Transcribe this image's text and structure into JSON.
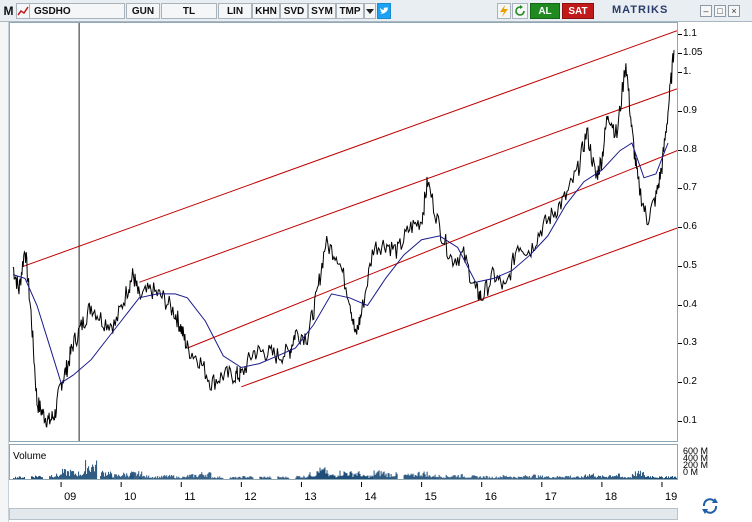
{
  "toolbar": {
    "menu_label": "M",
    "symbol": "GSDHO",
    "period": "GUN",
    "currency": "TL",
    "scale": "LIN",
    "khn": "KHN",
    "svd": "SVD",
    "sym": "SYM",
    "tmp": "TMP",
    "buy": "AL",
    "sell": "SAT",
    "brand": "MATRIKS"
  },
  "volume": {
    "title": "Volume",
    "scale_labels": [
      "600 M",
      "400 M",
      "200 M",
      "0 M"
    ]
  },
  "colors": {
    "price": "#000000",
    "moving_average": "#1a1a8c",
    "channel": "#c00000",
    "volume_bar": "#1f4e79"
  },
  "chart_data": {
    "type": "line",
    "title": "",
    "xlabel": "",
    "ylabel": "",
    "x_ticks": [
      "09",
      "10",
      "11",
      "12",
      "13",
      "14",
      "15",
      "16",
      "17",
      "18",
      "19"
    ],
    "y_ticks": [
      "0.1",
      "0.2",
      "0.3",
      "0.4",
      "0.5",
      "0.6",
      "0.7",
      "0.8",
      "0.9",
      "1.",
      "1.05",
      "1.1"
    ],
    "ylim": [
      0.05,
      1.13
    ],
    "xlim": [
      2008.15,
      2019.25
    ],
    "grid": false,
    "series": [
      {
        "x": [
          2008.2,
          2008.3,
          2008.4,
          2008.5,
          2008.6,
          2008.7,
          2008.8,
          2008.9,
          2009.0,
          2009.1,
          2009.2,
          2009.35,
          2009.5,
          2009.7,
          2009.9,
          2010.1,
          2010.2,
          2010.3,
          2010.5,
          2010.7,
          2010.9,
          2011.0,
          2011.1,
          2011.3,
          2011.5,
          2011.7,
          2011.9,
          2012.0,
          2012.2,
          2012.4,
          2012.6,
          2012.8,
          2012.9,
          2013.1,
          2013.25,
          2013.4,
          2013.6,
          2013.8,
          2013.9,
          2014.0,
          2014.2,
          2014.4,
          2014.6,
          2014.8,
          2015.0,
          2015.1,
          2015.3,
          2015.5,
          2015.7,
          2015.9,
          2016.0,
          2016.2,
          2016.4,
          2016.6,
          2016.8,
          2017.0,
          2017.2,
          2017.4,
          2017.6,
          2017.75,
          2017.9,
          2018.0,
          2018.1,
          2018.25,
          2018.4,
          2018.5,
          2018.6,
          2018.75,
          2018.9,
          2019.0,
          2019.1,
          2019.2
        ],
        "values": [
          0.5,
          0.44,
          0.55,
          0.38,
          0.15,
          0.12,
          0.1,
          0.12,
          0.2,
          0.24,
          0.3,
          0.35,
          0.4,
          0.36,
          0.35,
          0.44,
          0.48,
          0.42,
          0.44,
          0.42,
          0.38,
          0.34,
          0.29,
          0.26,
          0.2,
          0.22,
          0.22,
          0.22,
          0.28,
          0.28,
          0.27,
          0.28,
          0.33,
          0.32,
          0.42,
          0.56,
          0.53,
          0.42,
          0.32,
          0.38,
          0.55,
          0.56,
          0.54,
          0.6,
          0.62,
          0.72,
          0.6,
          0.52,
          0.53,
          0.44,
          0.42,
          0.48,
          0.44,
          0.56,
          0.54,
          0.6,
          0.64,
          0.68,
          0.75,
          0.85,
          0.73,
          0.78,
          0.9,
          0.84,
          1.03,
          0.85,
          0.72,
          0.62,
          0.68,
          0.76,
          0.9,
          1.06
        ]
      },
      {
        "x": [
          2008.2,
          2008.4,
          2008.6,
          2008.8,
          2009.0,
          2009.2,
          2009.5,
          2009.8,
          2010.0,
          2010.3,
          2010.6,
          2010.9,
          2011.1,
          2011.4,
          2011.7,
          2012.0,
          2012.3,
          2012.6,
          2012.9,
          2013.2,
          2013.5,
          2013.8,
          2014.1,
          2014.4,
          2014.7,
          2015.0,
          2015.3,
          2015.6,
          2015.9,
          2016.2,
          2016.5,
          2016.8,
          2017.1,
          2017.4,
          2017.7,
          2018.0,
          2018.3,
          2018.5,
          2018.7,
          2018.9,
          2019.1
        ],
        "values": [
          0.48,
          0.47,
          0.4,
          0.3,
          0.2,
          0.22,
          0.26,
          0.32,
          0.36,
          0.42,
          0.43,
          0.43,
          0.42,
          0.36,
          0.27,
          0.24,
          0.25,
          0.27,
          0.29,
          0.35,
          0.43,
          0.42,
          0.4,
          0.47,
          0.53,
          0.57,
          0.58,
          0.55,
          0.46,
          0.47,
          0.49,
          0.53,
          0.58,
          0.66,
          0.72,
          0.75,
          0.8,
          0.82,
          0.73,
          0.74,
          0.82
        ]
      },
      {
        "x": [
          2008.35,
          2019.25
        ],
        "values": [
          0.5,
          1.11
        ]
      },
      {
        "x": [
          2010.3,
          2019.25
        ],
        "values": [
          0.46,
          0.96
        ]
      },
      {
        "x": [
          2011.1,
          2019.25
        ],
        "values": [
          0.29,
          0.8
        ]
      },
      {
        "x": [
          2012.0,
          2019.25
        ],
        "values": [
          0.19,
          0.6
        ]
      }
    ],
    "volume": {
      "x": [
        2008.3,
        2008.6,
        2008.9,
        2009.1,
        2009.3,
        2009.5,
        2009.75,
        2009.9,
        2010.1,
        2010.25,
        2010.4,
        2010.6,
        2010.8,
        2011.0,
        2011.2,
        2011.4,
        2011.6,
        2011.9,
        2012.1,
        2012.4,
        2012.7,
        2013.0,
        2013.2,
        2013.35,
        2013.5,
        2013.7,
        2013.9,
        2014.1,
        2014.3,
        2014.5,
        2014.8,
        2015.0,
        2015.2,
        2015.4,
        2015.6,
        2015.8,
        2016.0,
        2016.2,
        2016.4,
        2016.6,
        2016.8,
        2017.0,
        2017.2,
        2017.4,
        2017.6,
        2017.8,
        2018.0,
        2018.2,
        2018.4,
        2018.6,
        2018.8,
        2019.0,
        2019.15
      ],
      "values": [
        60,
        90,
        120,
        220,
        180,
        420,
        200,
        110,
        150,
        170,
        80,
        70,
        90,
        60,
        110,
        160,
        60,
        50,
        70,
        60,
        60,
        80,
        150,
        260,
        120,
        200,
        180,
        90,
        200,
        150,
        120,
        180,
        100,
        90,
        110,
        80,
        70,
        60,
        90,
        60,
        110,
        80,
        70,
        90,
        60,
        140,
        80,
        120,
        60,
        180,
        90,
        60,
        70
      ],
      "ylim": [
        0,
        650
      ]
    }
  }
}
